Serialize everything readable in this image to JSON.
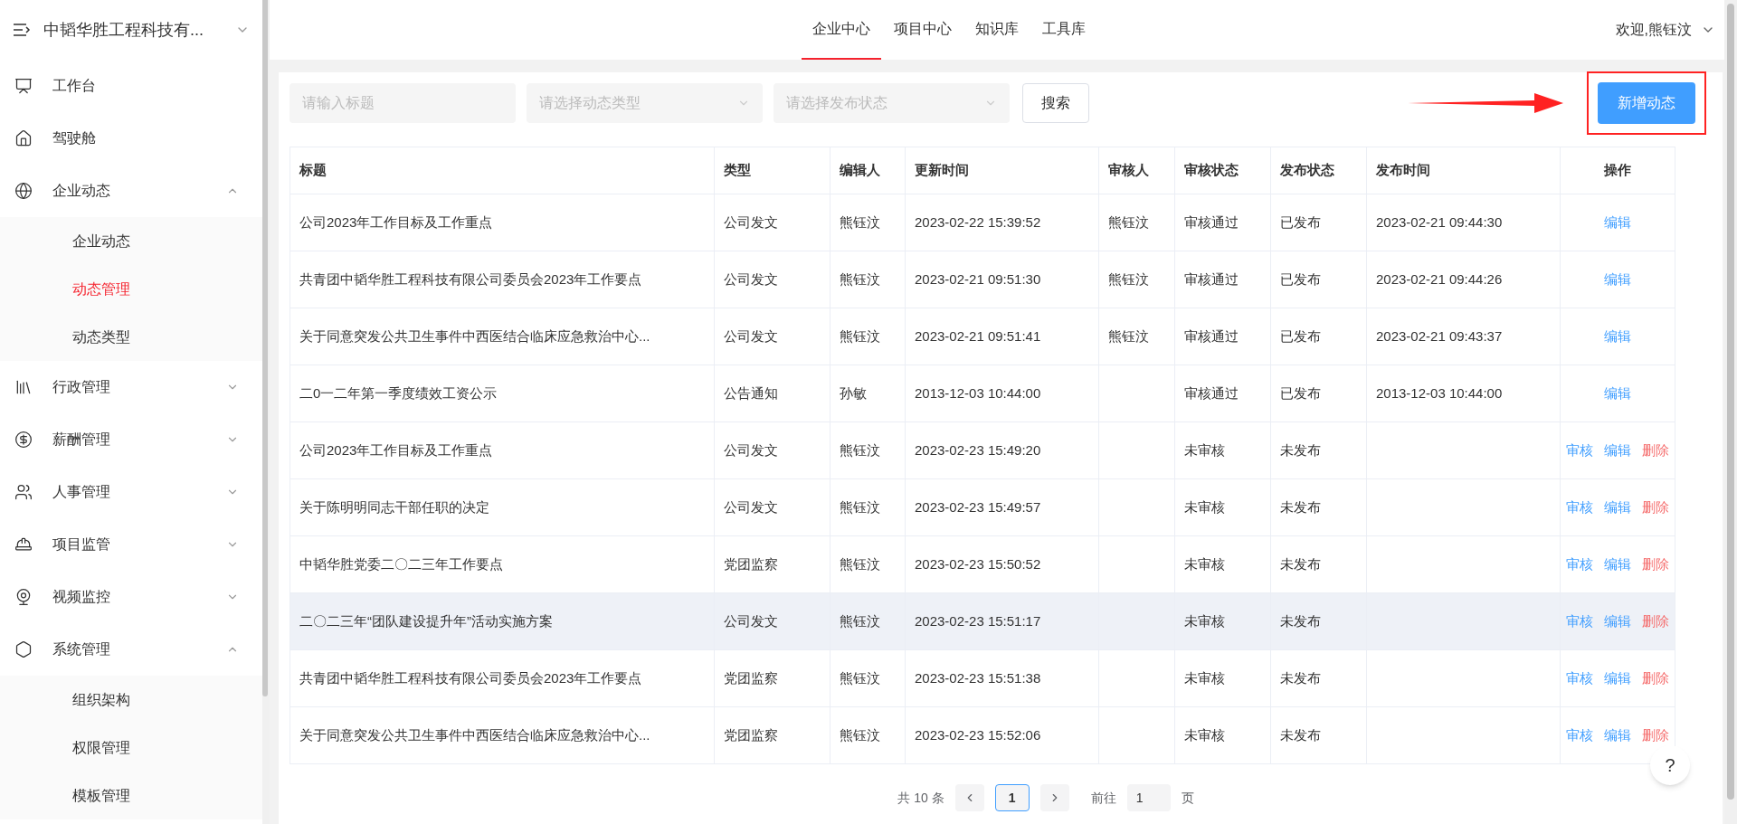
{
  "sidebar": {
    "title": "中韬华胜工程科技有...",
    "items": [
      {
        "label": "工作台"
      },
      {
        "label": "驾驶舱"
      },
      {
        "label": "企业动态",
        "expanded": true,
        "children": [
          {
            "label": "企业动态",
            "selected": false
          },
          {
            "label": "动态管理",
            "selected": true
          },
          {
            "label": "动态类型",
            "selected": false
          }
        ]
      },
      {
        "label": "行政管理",
        "expanded": false
      },
      {
        "label": "薪酬管理",
        "expanded": false
      },
      {
        "label": "人事管理",
        "expanded": false
      },
      {
        "label": "项目监管",
        "expanded": false
      },
      {
        "label": "视频监控",
        "expanded": false
      },
      {
        "label": "系统管理",
        "expanded": true,
        "children": [
          {
            "label": "组织架构",
            "selected": false
          },
          {
            "label": "权限管理",
            "selected": false
          },
          {
            "label": "模板管理",
            "selected": false
          }
        ]
      }
    ]
  },
  "header": {
    "tabs": [
      {
        "label": "企业中心",
        "selected": true
      },
      {
        "label": "项目中心",
        "selected": false
      },
      {
        "label": "知识库",
        "selected": false
      },
      {
        "label": "工具库",
        "selected": false
      }
    ],
    "user": "欢迎,熊钰汶"
  },
  "filters": {
    "title_field": {
      "placeholder": "请输入标题"
    },
    "type_select": {
      "placeholder": "请选择动态类型"
    },
    "status_select": {
      "placeholder": "请选择发布状态"
    },
    "search_button": "搜索",
    "add_button": {
      "label": "新增动态",
      "highlighted": true
    }
  },
  "table": {
    "columns": [
      "标题",
      "类型",
      "编辑人",
      "更新时间",
      "审核人",
      "审核状态",
      "发布状态",
      "发布时间",
      "操作"
    ],
    "rows": [
      {
        "selected": false,
        "title": "公司2023年工作目标及工作重点",
        "type": "公司发文",
        "editor": "熊钰汶",
        "updated": "2023-02-22 15:39:52",
        "reviewer": "熊钰汶",
        "review_status": "审核通过",
        "publish_status": "已发布",
        "published": "2023-02-21 09:44:30",
        "actions": [
          {
            "kind": "edit",
            "label": "编辑"
          }
        ]
      },
      {
        "selected": false,
        "title": "共青团中韬华胜工程科技有限公司委员会2023年工作要点",
        "type": "公司发文",
        "editor": "熊钰汶",
        "updated": "2023-02-21 09:51:30",
        "reviewer": "熊钰汶",
        "review_status": "审核通过",
        "publish_status": "已发布",
        "published": "2023-02-21 09:44:26",
        "actions": [
          {
            "kind": "edit",
            "label": "编辑"
          }
        ]
      },
      {
        "selected": false,
        "title": "关于同意突发公共卫生事件中西医结合临床应急救治中心...",
        "type": "公司发文",
        "editor": "熊钰汶",
        "updated": "2023-02-21 09:51:41",
        "reviewer": "熊钰汶",
        "review_status": "审核通过",
        "publish_status": "已发布",
        "published": "2023-02-21 09:43:37",
        "actions": [
          {
            "kind": "edit",
            "label": "编辑"
          }
        ]
      },
      {
        "selected": false,
        "title": "二0一二年第一季度绩效工资公示",
        "type": "公告通知",
        "editor": "孙敏",
        "updated": "2013-12-03 10:44:00",
        "review_status": "审核通过",
        "publish_status": "已发布",
        "published": "2013-12-03 10:44:00",
        "actions": [
          {
            "kind": "edit",
            "label": "编辑"
          }
        ]
      },
      {
        "selected": false,
        "title": "公司2023年工作目标及工作重点",
        "type": "公司发文",
        "editor": "熊钰汶",
        "updated": "2023-02-23 15:49:20",
        "review_status": "未审核",
        "publish_status": "未发布",
        "actions": [
          {
            "kind": "review",
            "label": "审核"
          },
          {
            "kind": "edit",
            "label": "编辑"
          },
          {
            "kind": "delete",
            "label": "删除"
          }
        ]
      },
      {
        "selected": false,
        "title": "关于陈明明同志干部任职的决定",
        "type": "公司发文",
        "editor": "熊钰汶",
        "updated": "2023-02-23 15:49:57",
        "review_status": "未审核",
        "publish_status": "未发布",
        "actions": [
          {
            "kind": "review",
            "label": "审核"
          },
          {
            "kind": "edit",
            "label": "编辑"
          },
          {
            "kind": "delete",
            "label": "删除"
          }
        ]
      },
      {
        "selected": false,
        "title": "中韬华胜党委二〇二三年工作要点",
        "type": "党团监察",
        "editor": "熊钰汶",
        "updated": "2023-02-23 15:50:52",
        "review_status": "未审核",
        "publish_status": "未发布",
        "actions": [
          {
            "kind": "review",
            "label": "审核"
          },
          {
            "kind": "edit",
            "label": "编辑"
          },
          {
            "kind": "delete",
            "label": "删除"
          }
        ]
      },
      {
        "selected": true,
        "title": "二〇二三年“团队建设提升年”活动实施方案",
        "type": "公司发文",
        "editor": "熊钰汶",
        "updated": "2023-02-23 15:51:17",
        "review_status": "未审核",
        "publish_status": "未发布",
        "actions": [
          {
            "kind": "review",
            "label": "审核"
          },
          {
            "kind": "edit",
            "label": "编辑"
          },
          {
            "kind": "delete",
            "label": "删除"
          }
        ]
      },
      {
        "selected": false,
        "title": "共青团中韬华胜工程科技有限公司委员会2023年工作要点",
        "type": "党团监察",
        "editor": "熊钰汶",
        "updated": "2023-02-23 15:51:38",
        "review_status": "未审核",
        "publish_status": "未发布",
        "actions": [
          {
            "kind": "review",
            "label": "审核"
          },
          {
            "kind": "edit",
            "label": "编辑"
          },
          {
            "kind": "delete",
            "label": "删除"
          }
        ]
      },
      {
        "selected": false,
        "title": "关于同意突发公共卫生事件中西医结合临床应急救治中心...",
        "type": "党团监察",
        "editor": "熊钰汶",
        "updated": "2023-02-23 15:52:06",
        "review_status": "未审核",
        "publish_status": "未发布",
        "actions": [
          {
            "kind": "review",
            "label": "审核"
          },
          {
            "kind": "edit",
            "label": "编辑"
          },
          {
            "kind": "delete",
            "label": "删除"
          }
        ]
      }
    ]
  },
  "pagination": {
    "total": "共 10 条",
    "pages": [
      {
        "label": "1",
        "selected": true
      }
    ],
    "goto_label": "前往",
    "goto_value": "1",
    "page_unit": "页"
  },
  "help_button": "?"
}
